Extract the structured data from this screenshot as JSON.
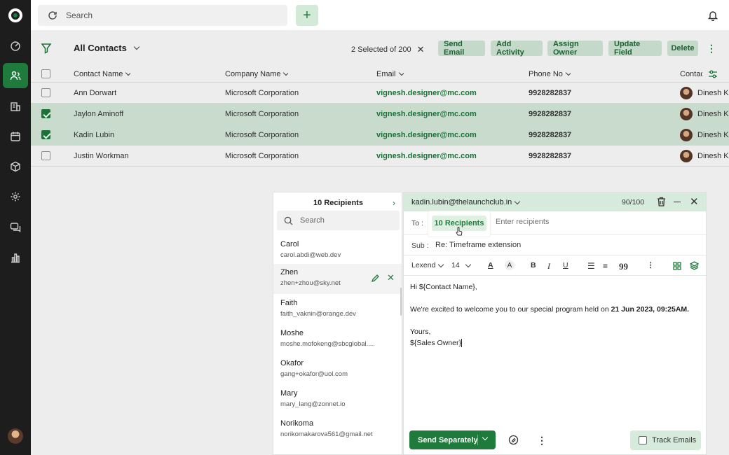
{
  "topbar": {
    "search_placeholder": "Search",
    "add_label": "+"
  },
  "toolbar": {
    "view_title": "All Contacts",
    "selected_info": "2 Selected of 200",
    "buttons": [
      "Send Email",
      "Add Activity",
      "Assign Owner",
      "Update Field",
      "Delete"
    ]
  },
  "table": {
    "headers": [
      "Contact Name",
      "Company Name",
      "Email",
      "Phone No",
      "Contac"
    ],
    "rows": [
      {
        "name": "Ann Dorwart",
        "company": "Microsoft Corporation",
        "email": "vignesh.designer@mc.com",
        "phone": "9928282837",
        "owner": "Dinesh Ku",
        "checked": false
      },
      {
        "name": "Jaylon Aminoff",
        "company": "Microsoft Corporation",
        "email": "vignesh.designer@mc.com",
        "phone": "9928282837",
        "owner": "Dinesh Ku",
        "checked": true
      },
      {
        "name": "Kadin Lubin",
        "company": "Microsoft Corporation",
        "email": "vignesh.designer@mc.com",
        "phone": "9928282837",
        "owner": "Dinesh Ku",
        "checked": true
      },
      {
        "name": "Justin Workman",
        "company": "Microsoft Corporation",
        "email": "vignesh.designer@mc.com",
        "phone": "9928282837",
        "owner": "Dinesh Ku",
        "checked": false
      }
    ]
  },
  "recipients": {
    "title": "10 Recipients",
    "search_placeholder": "Search",
    "items": [
      {
        "name": "Carol",
        "email": "carol.abdi@web.dev"
      },
      {
        "name": "Zhen",
        "email": "zhen+zhou@sky.net"
      },
      {
        "name": "Faith",
        "email": "faith_vaknin@orange.dev"
      },
      {
        "name": "Moshe",
        "email": "moshe.mofokeng@sbcglobal...."
      },
      {
        "name": "Okafor",
        "email": "gang+okafor@uol.com"
      },
      {
        "name": "Mary",
        "email": "mary_lang@zonnet.io"
      },
      {
        "name": "Norikoma",
        "email": "norikomakarova561@gmail.net"
      }
    ]
  },
  "composer": {
    "from": "kadin.lubin@thelaunchclub.in",
    "count": "90/100",
    "to_label": "To :",
    "recipients_chip": "10 Recipients",
    "to_placeholder": "Enter recipients",
    "sub_label": "Sub :",
    "subject": "Re: Timeframe extension",
    "font": "Lexend",
    "font_size": "14",
    "body_greeting": "Hi ${Contact Name},",
    "body_line_pre": "We're excited to welcome you to our special program held on ",
    "body_line_date": "21 Jun 2023, 09:25AM.",
    "body_sign1": "Yours,",
    "body_sign2": "${Sales Owner}",
    "send_label": "Send Separately",
    "track_label": "Track Emails"
  },
  "colors": {
    "accent": "#1e7b3c",
    "accent_light": "#d3ead9",
    "rail": "#1c1d1c"
  }
}
